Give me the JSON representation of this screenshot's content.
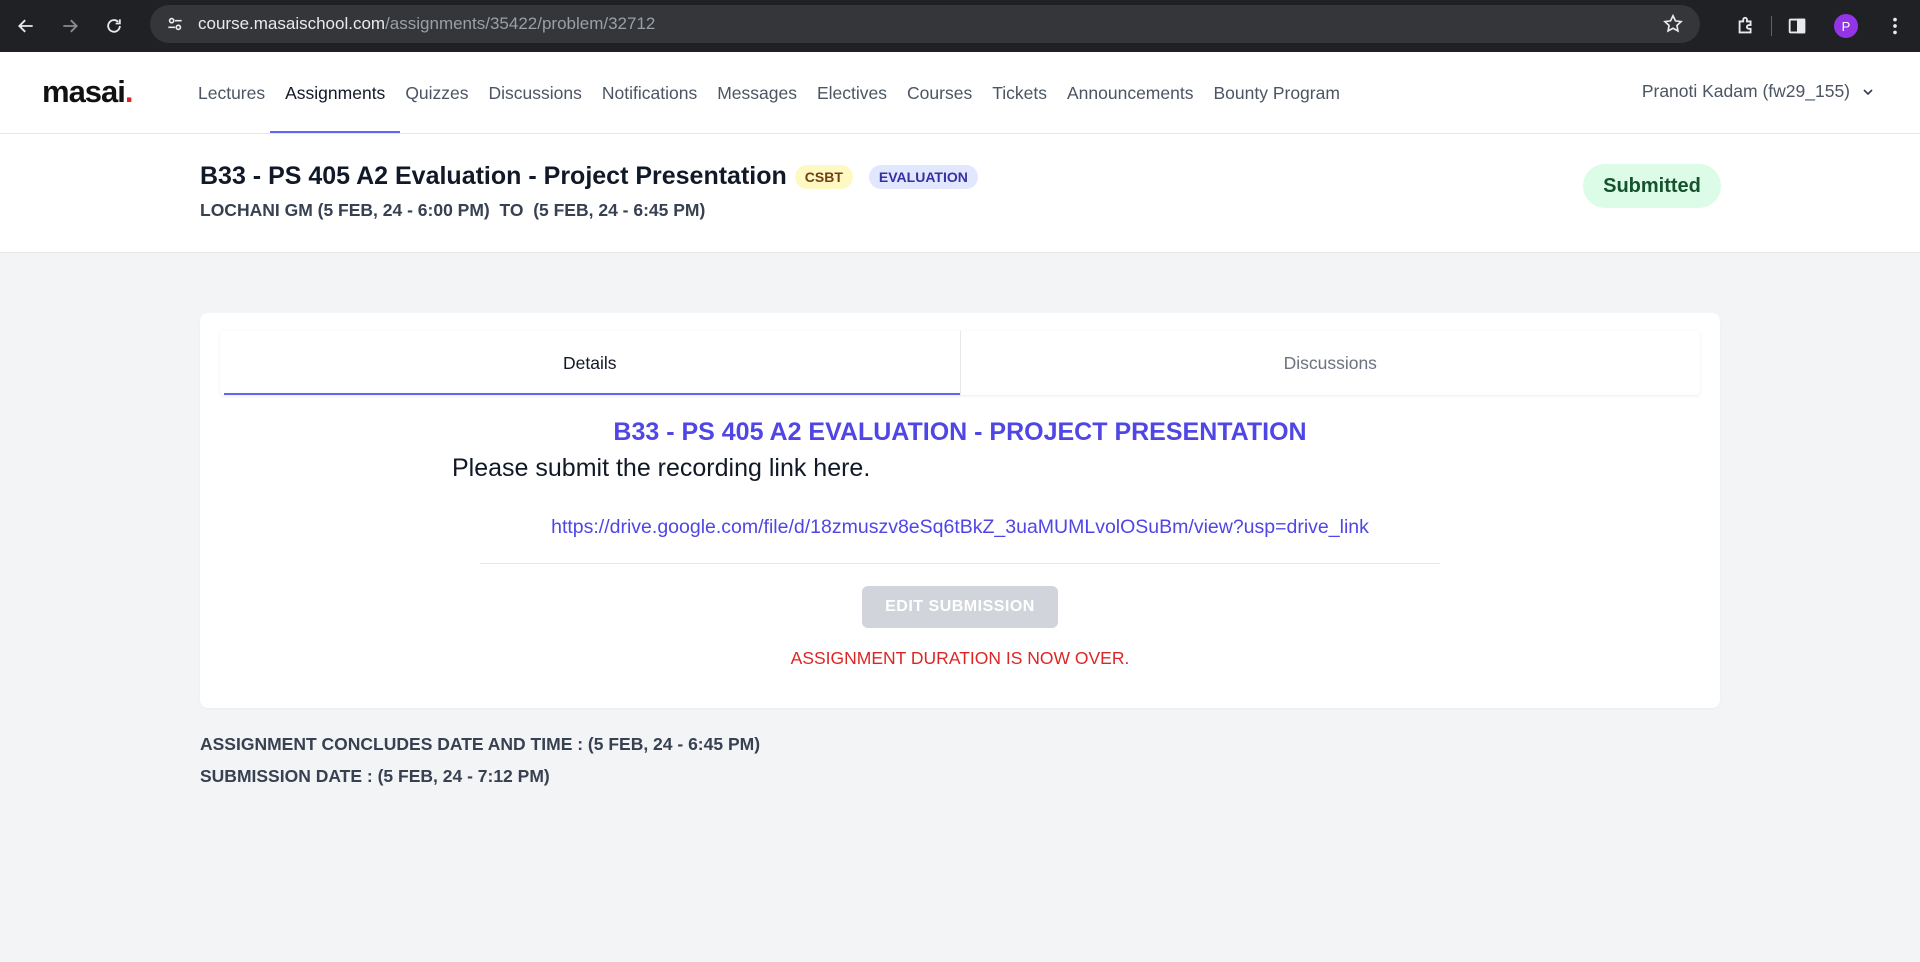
{
  "browser": {
    "url_domain": "course.masaischool.com",
    "url_path": "/assignments/35422/problem/32712",
    "profile_initial": "P"
  },
  "app": {
    "logo": "masai",
    "nav": [
      "Lectures",
      "Assignments",
      "Quizzes",
      "Discussions",
      "Notifications",
      "Messages",
      "Electives",
      "Courses",
      "Tickets",
      "Announcements",
      "Bounty Program"
    ],
    "active_nav": "Assignments",
    "user": "Pranoti Kadam (fw29_155)"
  },
  "assignment": {
    "title": "B33 - PS 405 A2 Evaluation - Project Presentation",
    "tags": [
      "CSBT",
      "EVALUATION"
    ],
    "meta": "LOCHANI GM (5 FEB, 24 - 6:00 PM)  TO  (5 FEB, 24 - 6:45 PM)",
    "status": "Submitted"
  },
  "tabs": [
    "Details",
    "Discussions"
  ],
  "content": {
    "problem_title": "B33 - PS 405 A2 EVALUATION - PROJECT PRESENTATION",
    "instruction": "Please submit the recording link here.",
    "submission_link": "https://drive.google.com/file/d/18zmuszv8eSq6tBkZ_3uaMUMLvolOSuBm/view?usp=drive_link",
    "edit_button": "EDIT SUBMISSION",
    "over_message": "ASSIGNMENT DURATION IS NOW OVER."
  },
  "footer": {
    "concludes": "ASSIGNMENT CONCLUDES DATE AND TIME : (5 FEB, 24 - 6:45 PM)",
    "submission_date": "SUBMISSION DATE : (5 FEB, 24 - 7:12 PM)"
  },
  "colors": {
    "accent": "#4f46e5",
    "status_bg": "#dcfce7",
    "warning": "#dc2626"
  }
}
